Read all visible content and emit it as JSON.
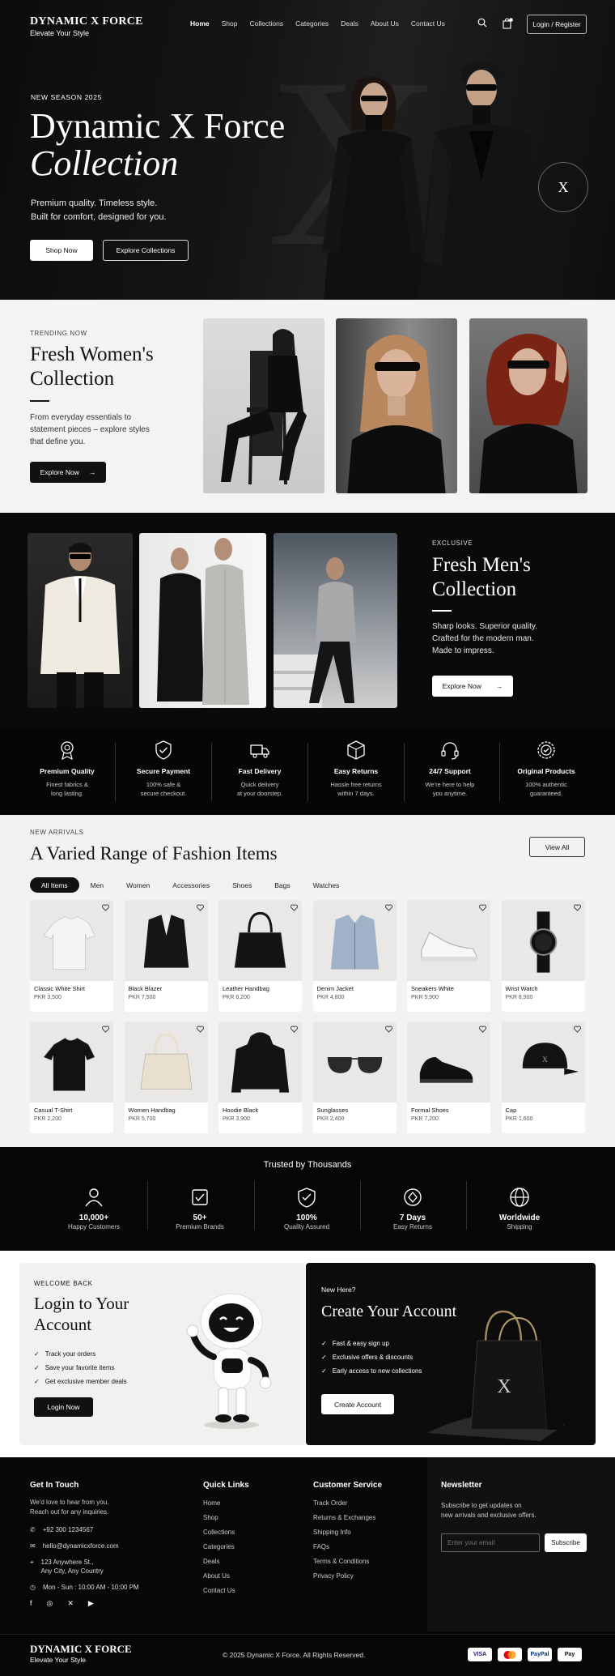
{
  "brand": {
    "name": "DYNAMIC X FORCE",
    "tagline": "Elevate Your Style"
  },
  "nav": {
    "items": [
      "Home",
      "Shop",
      "Collections",
      "Categories",
      "Deals",
      "About Us",
      "Contact Us"
    ],
    "active": "Home",
    "login_label": "Login / Register"
  },
  "hero": {
    "eyebrow": "NEW SEASON 2025",
    "title_line1": "Dynamic X Force",
    "title_line2": "Collection",
    "sub_line1": "Premium quality. Timeless style.",
    "sub_line2": "Built for comfort, designed for you.",
    "primary_btn": "Shop Now",
    "secondary_btn": "Explore Collections",
    "seal_letter": "X"
  },
  "women": {
    "eyebrow": "TRENDING NOW",
    "title_line1": "Fresh Women's",
    "title_line2": "Collection",
    "body_line1": "From everyday essentials to",
    "body_line2": "statement pieces – explore styles",
    "body_line3": "that define you.",
    "btn": "Explore Now"
  },
  "men": {
    "eyebrow": "EXCLUSIVE",
    "title_line1": "Fresh Men's",
    "title_line2": "Collection",
    "body_line1": "Sharp looks. Superior quality.",
    "body_line2": "Crafted for the modern man.",
    "body_line3": "Made to impress.",
    "btn": "Explore Now"
  },
  "features": [
    {
      "title": "Premium Quality",
      "d1": "Finest fabrics &",
      "d2": "long lasting.",
      "icon": "award-icon"
    },
    {
      "title": "Secure Payment",
      "d1": "100% safe &",
      "d2": "secure checkout.",
      "icon": "shield-check-icon"
    },
    {
      "title": "Fast Delivery",
      "d1": "Quick delivery",
      "d2": "at your doorstep.",
      "icon": "truck-icon"
    },
    {
      "title": "Easy Returns",
      "d1": "Hassle free returns",
      "d2": "within 7 days.",
      "icon": "box-icon"
    },
    {
      "title": "24/7 Support",
      "d1": "We're here to help",
      "d2": "you anytime.",
      "icon": "headset-icon"
    },
    {
      "title": "Original Products",
      "d1": "100% authentic",
      "d2": "guaranteed.",
      "icon": "badge-icon"
    }
  ],
  "arrivals": {
    "eyebrow": "NEW ARRIVALS",
    "title": "A Varied Range of Fashion Items",
    "view_all": "View All",
    "filters": [
      "All Items",
      "Men",
      "Women",
      "Accessories",
      "Shoes",
      "Bags",
      "Watches"
    ],
    "active_filter": "All Items",
    "products": [
      {
        "name": "Classic White Shirt",
        "price": "PKR 3,500",
        "icon": "tshirt-icon",
        "color": "#f4f4f4"
      },
      {
        "name": "Black Blazer",
        "price": "PKR 7,500",
        "icon": "blazer-icon",
        "color": "#151515"
      },
      {
        "name": "Leather Handbag",
        "price": "PKR 6,200",
        "icon": "handbag-icon",
        "color": "#141414"
      },
      {
        "name": "Denim Jacket",
        "price": "PKR 4,800",
        "icon": "jacket-icon",
        "color": "#9fb2c8"
      },
      {
        "name": "Sneakers White",
        "price": "PKR 5,900",
        "icon": "sneaker-icon",
        "color": "#f7f7f7"
      },
      {
        "name": "Wrist Watch",
        "price": "PKR 8,900",
        "icon": "watch-icon",
        "color": "#111111"
      },
      {
        "name": "Casual T-Shirt",
        "price": "PKR 2,200",
        "icon": "tshirt-icon",
        "color": "#121212"
      },
      {
        "name": "Women Handbag",
        "price": "PKR 5,700",
        "icon": "handbag-icon",
        "color": "#e8dfcf"
      },
      {
        "name": "Hoodie Black",
        "price": "PKR 3,900",
        "icon": "hoodie-icon",
        "color": "#131313"
      },
      {
        "name": "Sunglasses",
        "price": "PKR 2,400",
        "icon": "sunglasses-icon",
        "color": "#2a2a2a"
      },
      {
        "name": "Formal Shoes",
        "price": "PKR 7,200",
        "icon": "shoe-icon",
        "color": "#101010"
      },
      {
        "name": "Cap",
        "price": "PKR 1,600",
        "icon": "cap-icon",
        "color": "#121212"
      }
    ]
  },
  "trusted": {
    "title": "Trusted by Thousands",
    "stats": [
      {
        "value": "10,000+",
        "label": "Happy Customers",
        "icon": "users-icon"
      },
      {
        "value": "50+",
        "label": "Premium Brands",
        "icon": "brand-icon"
      },
      {
        "value": "100%",
        "label": "Quality Assured",
        "icon": "quality-icon"
      },
      {
        "value": "7 Days",
        "label": "Easy Returns",
        "icon": "return-icon"
      },
      {
        "value": "Worldwide",
        "label": "Shipping",
        "icon": "globe-icon"
      }
    ]
  },
  "login_panel": {
    "eyebrow": "WELCOME BACK",
    "title_line1": "Login to Your",
    "title_line2": "Account",
    "checks": [
      "Track your orders",
      "Save your favorite items",
      "Get exclusive member deals"
    ],
    "btn": "Login Now"
  },
  "signup_panel": {
    "eyebrow": "New Here?",
    "title": "Create Your Account",
    "checks": [
      "Fast & easy sign up",
      "Exclusive offers & discounts",
      "Early access to new collections"
    ],
    "btn": "Create Account",
    "bag_letter": "X"
  },
  "footer": {
    "contact": {
      "title": "Get In Touch",
      "intro1": "We'd love to hear from you.",
      "intro2": "Reach out for any inquiries.",
      "phone": "+92 300 1234567",
      "email": "hello@dynamicxforce.com",
      "addr1": "123 Anywhere St.,",
      "addr2": "Any City, Any Country",
      "hours": "Mon - Sun : 10:00 AM - 10:00 PM"
    },
    "quick": {
      "title": "Quick Links",
      "links": [
        "Home",
        "Shop",
        "Collections",
        "Categories",
        "Deals",
        "About Us",
        "Contact Us"
      ]
    },
    "service": {
      "title": "Customer Service",
      "links": [
        "Track Order",
        "Returns & Exchanges",
        "Shipping Info",
        "FAQs",
        "Terms & Conditions",
        "Privacy Policy"
      ]
    },
    "newsletter": {
      "title": "Newsletter",
      "text1": "Subscribe to get updates on",
      "text2": "new arrivals and exclusive offers.",
      "placeholder": "Enter your email",
      "btn": "Subscribe"
    },
    "copyright": "© 2025 Dynamic X Force. All Rights Reserved.",
    "payments": [
      "VISA",
      "mastercard",
      "PayPal",
      "Pay"
    ]
  }
}
